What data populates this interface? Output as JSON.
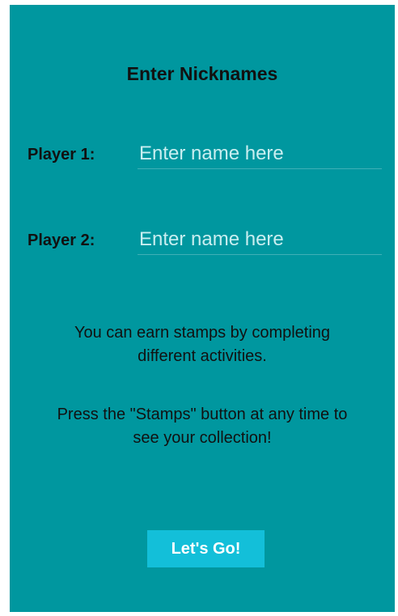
{
  "screen": {
    "title": "Enter Nicknames"
  },
  "players": [
    {
      "label": "Player 1:",
      "value": "",
      "placeholder": "Enter name here"
    },
    {
      "label": "Player 2:",
      "value": "",
      "placeholder": "Enter name here"
    }
  ],
  "info": {
    "line1": "You can earn stamps by completing different activities.",
    "line2": "Press the \"Stamps\" button at any time to see your collection!"
  },
  "actions": {
    "go_label": "Let's Go!"
  },
  "colors": {
    "background": "#00979f",
    "button": "#13bfd9",
    "placeholder": "#c9eef0"
  }
}
